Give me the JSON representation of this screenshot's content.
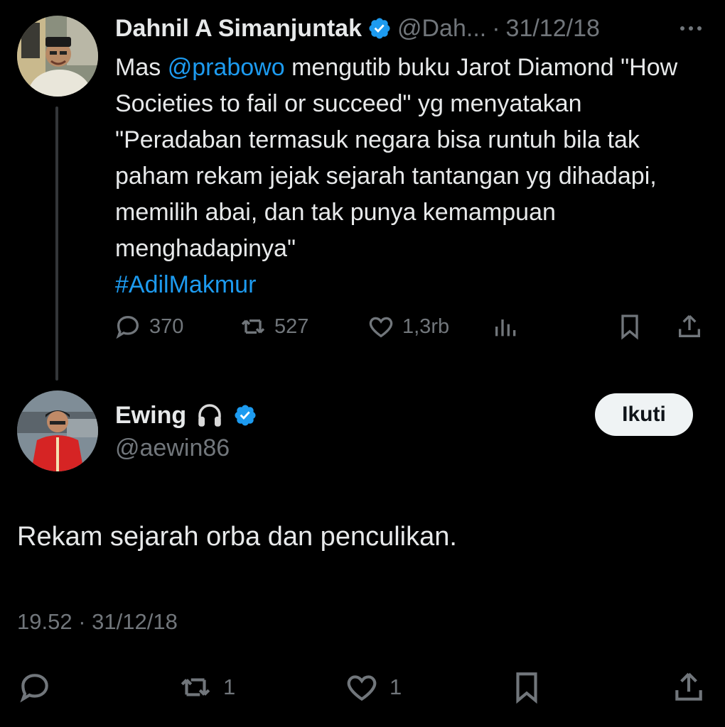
{
  "tweet": {
    "author_name": "Dahnil A Simanjuntak",
    "author_handle": "@Dah...",
    "separator": "·",
    "date": "31/12/18",
    "more_icon": "more-dots-icon",
    "text_prefix": "Mas ",
    "mention": "@prabowo",
    "text_body": " mengutib buku Jarot Diamond \"How Societies to fail or succeed\" yg menyatakan \"Peradaban termasuk negara bisa runtuh bila tak paham rekam jejak sejarah tantangan yg dihadapi, memilih abai, dan tak punya kemampuan menghadapinya\"",
    "hashtag": "#AdilMakmur",
    "stats": {
      "replies": "370",
      "retweets": "527",
      "likes": "1,3rb"
    }
  },
  "reply": {
    "author_name": "Ewing",
    "author_handle": "@aewin86",
    "follow_label": "Ikuti",
    "text": "Rekam sejarah orba dan penculikan.",
    "time": "19.52",
    "separator": "·",
    "date": "31/12/18",
    "stats": {
      "retweets": "1",
      "likes": "1"
    }
  },
  "colors": {
    "background": "#000000",
    "text": "#e7e9ea",
    "muted": "#71767b",
    "link": "#1d9bf0",
    "verified": "#1d9bf0"
  }
}
